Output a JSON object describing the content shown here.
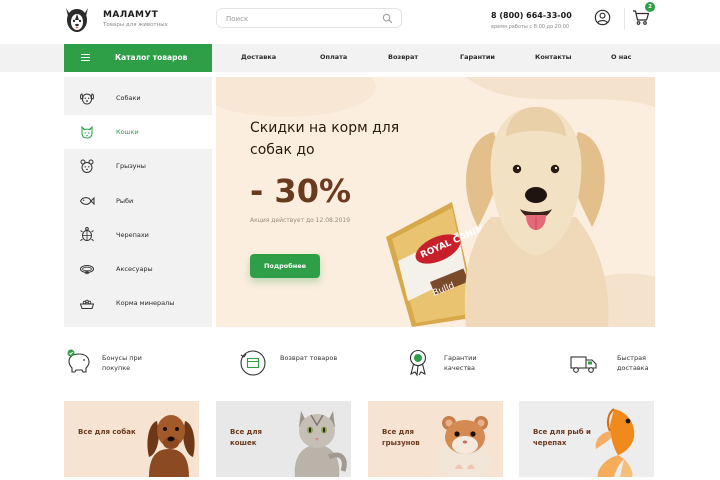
{
  "brand": {
    "name": "МАЛАМУТ",
    "tagline": "Товары для животных"
  },
  "search": {
    "placeholder": "Поиск",
    "value": ""
  },
  "contact": {
    "phone": "8 (800) 664-33-00",
    "hours": "время работы с 8:00 до 20:00"
  },
  "cart": {
    "count": "2"
  },
  "nav": {
    "catalog_label": "Каталог товаров",
    "items": [
      "Доставка",
      "Оплата",
      "Возврат",
      "Гарантии",
      "Контакты",
      "О нас"
    ]
  },
  "sidebar": {
    "items": [
      {
        "label": "Собаки",
        "icon": "dog-icon"
      },
      {
        "label": "Кошки",
        "icon": "cat-icon",
        "active": true
      },
      {
        "label": "Грызуны",
        "icon": "rodent-icon"
      },
      {
        "label": "Рыби",
        "icon": "fish-icon"
      },
      {
        "label": "Черепахи",
        "icon": "turtle-icon"
      },
      {
        "label": "Аксесуары",
        "icon": "collar-icon"
      },
      {
        "label": "Корма минералы",
        "icon": "food-bowl-icon"
      }
    ]
  },
  "banner": {
    "title": "Скидки на корм для собак до",
    "discount": "- 30%",
    "note": "Акция действует до 12.08.2019",
    "button_label": "Подробнее",
    "package_brand": "ROYAL CANIN",
    "package_label": "Bulld"
  },
  "features": [
    {
      "label": "Бонусы при покупке",
      "icon": "piggy-bank-icon"
    },
    {
      "label": "Возврат товаров",
      "icon": "return-box-icon"
    },
    {
      "label": "Гарантии качества",
      "icon": "quality-badge-icon"
    },
    {
      "label": "Быстрая доставка",
      "icon": "delivery-truck-icon"
    }
  ],
  "categories": [
    {
      "label": "Все для собак",
      "bg": "#f6e3d2"
    },
    {
      "label": "Все для кошек",
      "bg": "#e8e8e8"
    },
    {
      "label": "Все для грызунов",
      "bg": "#f6e3d2"
    },
    {
      "label": "Все для рыб и черепах",
      "bg": "#ededed"
    }
  ],
  "colors": {
    "accent": "#2e9e47",
    "brown": "#6b3a1e",
    "banner_bg": "#fbeedf"
  }
}
